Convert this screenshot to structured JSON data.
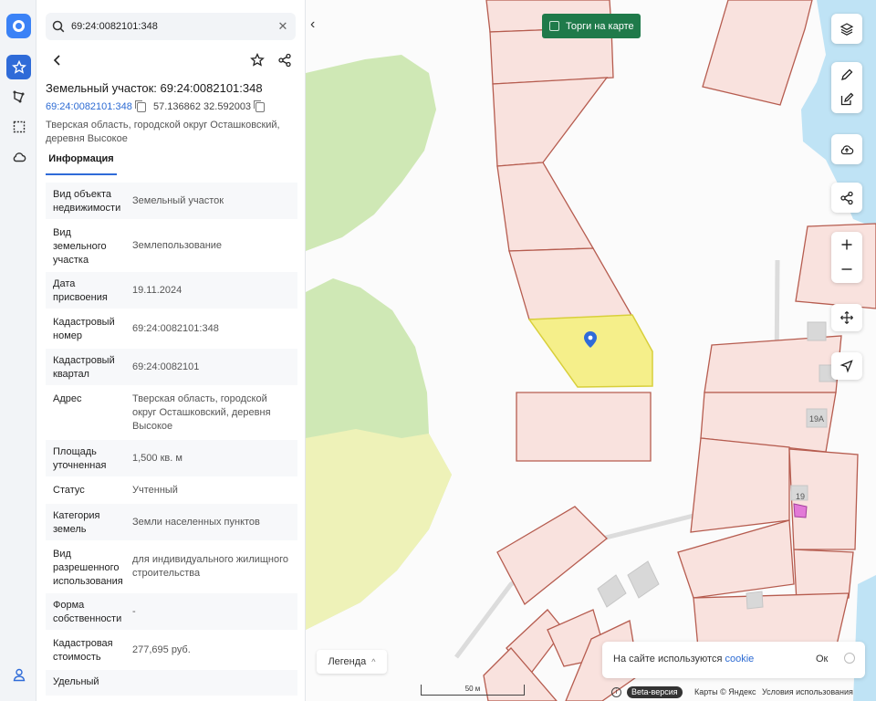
{
  "search": {
    "value": "69:24:0082101:348"
  },
  "panel": {
    "title": "Земельный участок: 69:24:0082101:348",
    "cadastral_link": "69:24:0082101:348",
    "coordinates": "57.136862 32.592003",
    "address": "Тверская область, городской округ Осташковский, деревня Высокое",
    "tab_label": "Информация",
    "rows": [
      {
        "key": "Вид объекта недвижимости",
        "value": "Земельный участок"
      },
      {
        "key": "Вид земельного участка",
        "value": "Землепользование"
      },
      {
        "key": "Дата присвоения",
        "value": "19.11.2024"
      },
      {
        "key": "Кадастровый номер",
        "value": "69:24:0082101:348"
      },
      {
        "key": "Кадастровый квартал",
        "value": "69:24:0082101"
      },
      {
        "key": "Адрес",
        "value": "Тверская область, городской округ Осташковский, деревня Высокое"
      },
      {
        "key": "Площадь уточненная",
        "value": "1,500 кв. м"
      },
      {
        "key": "Статус",
        "value": "Учтенный"
      },
      {
        "key": "Категория земель",
        "value": "Земли населенных пунктов"
      },
      {
        "key": "Вид разрешенного использования",
        "value": "для индивидуального жилищного строительства"
      },
      {
        "key": "Форма собственности",
        "value": "-"
      },
      {
        "key": "Кадастровая стоимость",
        "value": "277,695 руб."
      },
      {
        "key": "Удельный",
        "value": ""
      }
    ]
  },
  "map": {
    "auction_label": "Торги на карте",
    "legend_label": "Легенда",
    "parcel_labels": [
      "19А",
      "19"
    ],
    "scale_label": "50 м",
    "beta_label": "Beta-версия",
    "attribution": "Карты © Яндекс",
    "terms_label": "Условия использования",
    "cookie_text": "На сайте используются",
    "cookie_link": "cookie",
    "cookie_ok": "Ок"
  },
  "colors": {
    "accent": "#2f6bd8",
    "parcel_fill": "#f9e2de",
    "parcel_stroke": "#b65c4f",
    "selected_fill": "#f5ef8a",
    "forest": "#cfe8b5",
    "water": "#bfe3f5",
    "auction_bg": "#1f7a4a"
  }
}
